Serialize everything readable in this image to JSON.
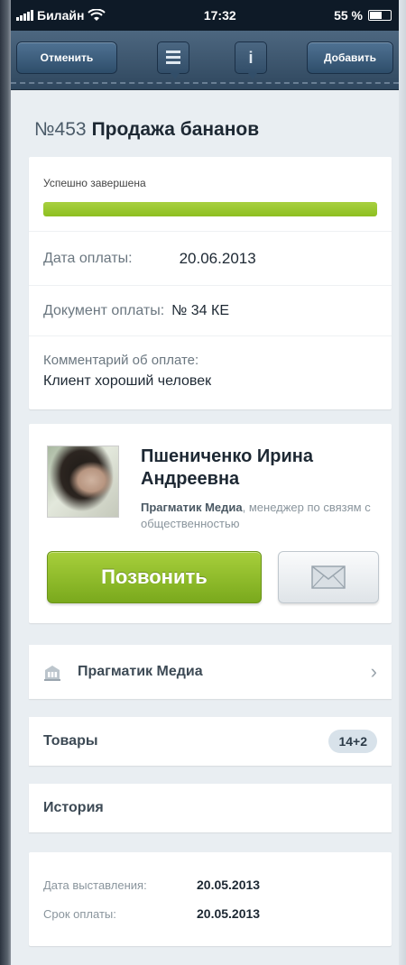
{
  "status_bar": {
    "carrier": "Билайн",
    "time": "17:32",
    "battery": "55 %"
  },
  "nav": {
    "cancel_label": "Отменить",
    "add_label": "Добавить"
  },
  "deal": {
    "number": "№453",
    "title": "Продажа бананов"
  },
  "payment": {
    "status_label": "Успешно завершена",
    "progress": 1.0,
    "date_label": "Дата оплаты:",
    "date_value": "20.06.2013",
    "doc_label": "Документ оплаты:",
    "doc_value": "№ 34 КЕ",
    "comment_label": "Комментарий об оплате:",
    "comment_value": "Клиент хороший человек"
  },
  "contact": {
    "name_line1": "Пшениченко Ирина",
    "name_line2": "Андреевна",
    "org": "Прагматик Медиа",
    "role": ", менеджер по связям с общественностью",
    "call_label": "Позвонить"
  },
  "company_row": {
    "label": "Прагматик Медиа",
    "chevron": "›"
  },
  "goods_row": {
    "label": "Товары",
    "badge": "14+2"
  },
  "history_row": {
    "label": "История"
  },
  "dates": {
    "issued_label": "Дата выставления:",
    "issued_value": "20.05.2013",
    "due_label": "Срок оплаты:",
    "due_value": "20.05.2013"
  },
  "colors": {
    "accent_green": "#8dbf20",
    "nav_blue": "#2f475e"
  },
  "icons": [
    "wifi-icon",
    "battery-icon",
    "list-icon",
    "info-icon",
    "building-icon",
    "chevron-right-icon",
    "envelope-icon"
  ]
}
